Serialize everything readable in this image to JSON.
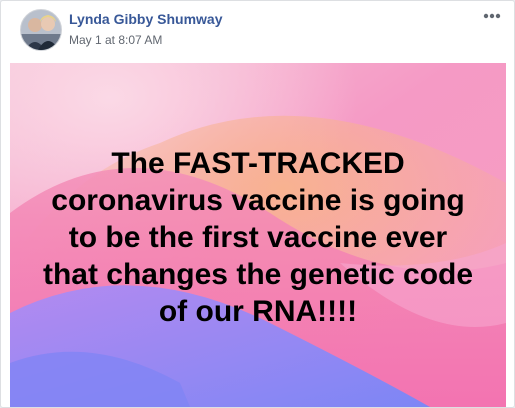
{
  "post": {
    "author": "Lynda Gibby Shumway",
    "timestamp": "May 1 at 8:07 AM",
    "avatar_icon": "profile-photo",
    "more_icon": "ellipsis-horizontal-icon",
    "text": "The FAST-TRACKED\ncoronavirus vaccine is going\nto be the first vaccine ever\nthat changes the genetic code\nof our RNA!!!!"
  },
  "colors": {
    "author": "#385898",
    "timestamp": "#616770",
    "gradient_pink": "#f7a3c7",
    "gradient_magenta": "#f26cb3",
    "gradient_purple": "#8b7bf0",
    "gradient_orange": "#f6a07a"
  }
}
